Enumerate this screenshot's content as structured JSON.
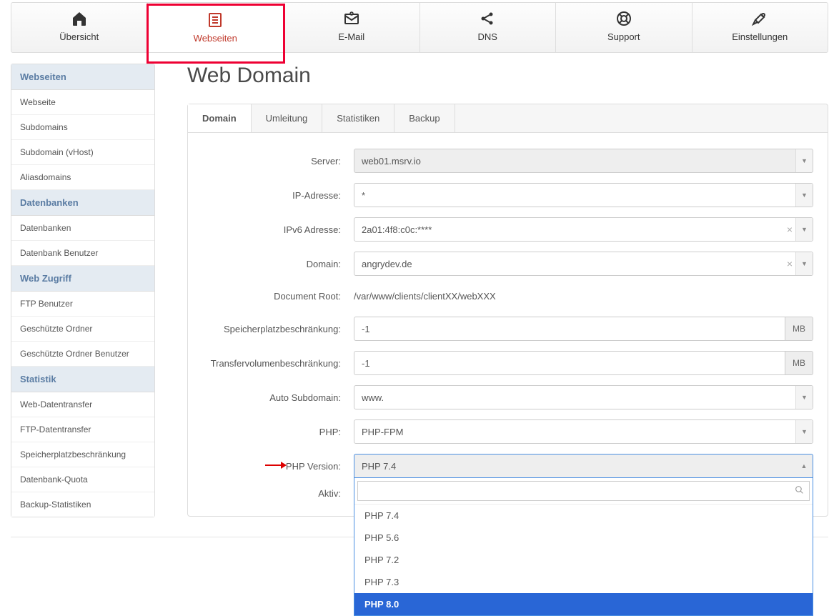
{
  "topnav": [
    {
      "label": "Übersicht",
      "icon": "home"
    },
    {
      "label": "Webseiten",
      "icon": "file",
      "active": true
    },
    {
      "label": "E-Mail",
      "icon": "mail"
    },
    {
      "label": "DNS",
      "icon": "share"
    },
    {
      "label": "Support",
      "icon": "lifebuoy"
    },
    {
      "label": "Einstellungen",
      "icon": "tools"
    }
  ],
  "sidebar": {
    "sections": [
      {
        "header": "Webseiten",
        "items": [
          "Webseite",
          "Subdomains",
          "Subdomain (vHost)",
          "Aliasdomains"
        ]
      },
      {
        "header": "Datenbanken",
        "items": [
          "Datenbanken",
          "Datenbank Benutzer"
        ]
      },
      {
        "header": "Web Zugriff",
        "items": [
          "FTP Benutzer",
          "Geschützte Ordner",
          "Geschützte Ordner Benutzer"
        ]
      },
      {
        "header": "Statistik",
        "items": [
          "Web-Datentransfer",
          "FTP-Datentransfer",
          "Speicherplatzbeschränkung",
          "Datenbank-Quota",
          "Backup-Statistiken"
        ]
      }
    ]
  },
  "page_title": "Web Domain",
  "tabs": [
    "Domain",
    "Umleitung",
    "Statistiken",
    "Backup"
  ],
  "active_tab": "Domain",
  "form": {
    "server_label": "Server:",
    "server_value": "web01.msrv.io",
    "ip_label": "IP-Adresse:",
    "ip_value": "*",
    "ipv6_label": "IPv6 Adresse:",
    "ipv6_value": "2a01:4f8:c0c:****",
    "domain_label": "Domain:",
    "domain_value": "angrydev.de",
    "docroot_label": "Document Root:",
    "docroot_value": "/var/www/clients/clientXX/webXXX",
    "quota_label": "Speicherplatzbeschränkung:",
    "quota_value": "-1",
    "quota_unit": "MB",
    "traffic_label": "Transfervolumenbeschränkung:",
    "traffic_value": "-1",
    "traffic_unit": "MB",
    "autosub_label": "Auto Subdomain:",
    "autosub_value": "www.",
    "php_label": "PHP:",
    "php_value": "PHP-FPM",
    "phpver_label": "PHP Version:",
    "phpver_value": "PHP 7.4",
    "phpver_options": [
      "PHP 7.4",
      "PHP 5.6",
      "PHP 7.2",
      "PHP 7.3",
      "PHP 8.0"
    ],
    "phpver_highlighted": "PHP 8.0",
    "active_label": "Aktiv:",
    "search_placeholder": ""
  }
}
